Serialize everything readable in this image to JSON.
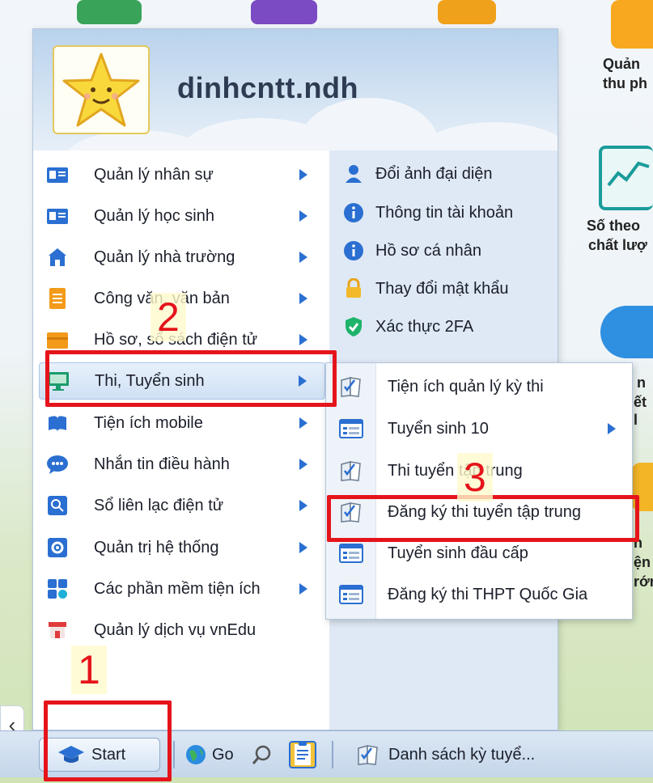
{
  "user": {
    "username": "dinhcntt.ndh"
  },
  "menu": {
    "items": [
      {
        "label": "Quản lý nhân sự",
        "icon": "id-card-icon",
        "has_submenu": true
      },
      {
        "label": "Quản lý học sinh",
        "icon": "student-card-icon",
        "has_submenu": true
      },
      {
        "label": "Quản lý nhà trường",
        "icon": "school-building-icon",
        "has_submenu": true
      },
      {
        "label": "Công văn, văn bản",
        "icon": "document-icon",
        "has_submenu": true
      },
      {
        "label": "Hồ sơ, sổ sách điện tử",
        "icon": "folder-box-icon",
        "has_submenu": true
      },
      {
        "label": "Thi, Tuyển sinh",
        "icon": "exam-monitor-icon",
        "has_submenu": true,
        "active": true
      },
      {
        "label": "Tiện ích mobile",
        "icon": "mobile-book-icon",
        "has_submenu": true
      },
      {
        "label": "Nhắn tin điều hành",
        "icon": "chat-bubble-icon",
        "has_submenu": true
      },
      {
        "label": "Sổ liên lạc điện tử",
        "icon": "contact-book-icon",
        "has_submenu": true
      },
      {
        "label": "Quản trị hệ thống",
        "icon": "system-gear-icon",
        "has_submenu": true
      },
      {
        "label": "Các phần mềm tiện ích",
        "icon": "apps-grid-icon",
        "has_submenu": true
      },
      {
        "label": "Quản lý dịch vụ vnEdu",
        "icon": "store-icon",
        "has_submenu": false
      }
    ]
  },
  "account": {
    "items": [
      {
        "label": "Đổi ảnh đại diện",
        "icon": "user-icon"
      },
      {
        "label": "Thông tin tài khoản",
        "icon": "info-icon"
      },
      {
        "label": "Hồ sơ cá nhân",
        "icon": "info-icon"
      },
      {
        "label": "Thay đổi mật khẩu",
        "icon": "lock-icon"
      },
      {
        "label": "Xác thực 2FA",
        "icon": "shield-check-icon"
      }
    ]
  },
  "submenu": {
    "items": [
      {
        "label": "Tiện ích quản lý kỳ thi",
        "icon": "exam-paper-icon",
        "has_submenu": false
      },
      {
        "label": "Tuyển sinh 10",
        "icon": "form-list-icon",
        "has_submenu": true
      },
      {
        "label": "Thi tuyển tập trung",
        "icon": "exam-paper-icon",
        "has_submenu": false
      },
      {
        "label": "Đăng ký thi tuyển tập trung",
        "icon": "exam-paper-icon",
        "has_submenu": false
      },
      {
        "label": "Tuyển sinh đầu cấp",
        "icon": "form-list-icon",
        "has_submenu": false
      },
      {
        "label": "Đăng ký thi THPT Quốc Gia",
        "icon": "form-list-icon",
        "has_submenu": false
      }
    ]
  },
  "annotations": {
    "step1": "1",
    "step2": "2",
    "step3": "3"
  },
  "taskbar": {
    "start_label": "Start",
    "go_label": "Go",
    "window_label": "Danh sách kỳ tuyể..."
  },
  "desktop": {
    "label1": "Quản",
    "label2": "thu ph",
    "label3": "Số theo",
    "label4": "chất lượ",
    "label5": "n",
    "label6": "ết l",
    "label7": "n",
    "label8": "ện",
    "label9": "rớn"
  },
  "colors": {
    "accent": "#2a6fd1",
    "annotation": "#e5141b"
  }
}
